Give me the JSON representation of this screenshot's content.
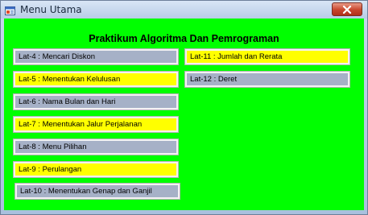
{
  "window": {
    "title": "Menu Utama"
  },
  "heading": "Praktikum Algoritma Dan Pemrograman",
  "colors": {
    "client_background": "#00ff00",
    "button_gray": "#a6b1c7",
    "button_yellow": "#ffff00",
    "close_button": "#c8452c"
  },
  "icons": {
    "app": "form-icon",
    "close": "close-icon"
  },
  "menu": {
    "lat4": "Lat-4 : Mencari  Diskon",
    "lat5": "Lat-5 : Menentukan Kelulusan",
    "lat6": "Lat-6 : Nama Bulan dan Hari",
    "lat7": "Lat-7 : Menentukan Jalur Perjalanan",
    "lat8": "Lat-8 : Menu Pilihan",
    "lat9": "Lat-9 : Perulangan",
    "lat10": "Lat-10 : Menentukan Genap dan Ganjil",
    "lat11": "Lat-11 : Jumlah dan Rerata",
    "lat12": "Lat-12 : Deret"
  }
}
